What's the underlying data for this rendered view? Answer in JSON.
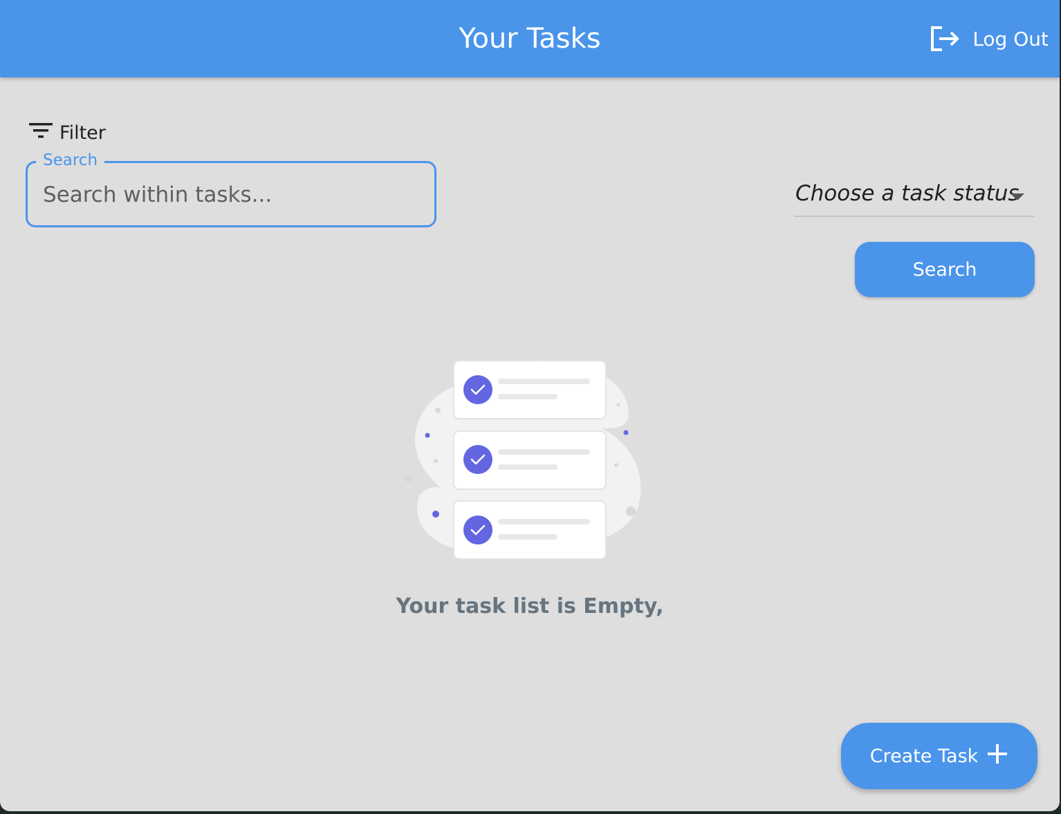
{
  "header": {
    "title": "Your Tasks",
    "logout_label": "Log Out",
    "logout_icon": "logout-icon",
    "color": "#4a94ea"
  },
  "filter": {
    "label": "Filter",
    "icon": "filter-icon"
  },
  "search": {
    "label": "Search",
    "placeholder": "Search within tasks...",
    "value": ""
  },
  "status_select": {
    "placeholder": "Choose a task status",
    "icon": "dropdown-caret-icon"
  },
  "search_button": {
    "label": "Search"
  },
  "empty_state": {
    "message": "Your task list is Empty,",
    "illustration": "task-list-illustration",
    "accent": "#6366e0"
  },
  "fab": {
    "label": "Create Task",
    "icon": "plus-icon"
  }
}
